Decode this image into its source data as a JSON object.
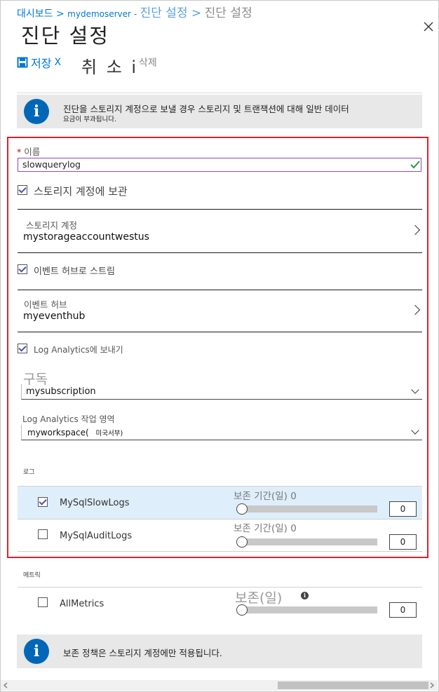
{
  "breadcrumb": {
    "item1": "대시보드 >",
    "item2": "mydemoserver -",
    "item3": "진단 설정 >",
    "current": "진단 설정"
  },
  "page_title": "진단 설정",
  "toolbar": {
    "save": "저장",
    "save_x": "X",
    "cancel": "취 소 i",
    "delete": "삭제"
  },
  "info_top": {
    "line1": "진단을 스토리지 계정으로 보낼 경우 스토리지 및 트랜잭션에 대해 일반 데이터",
    "line2": "요금이 부과됩니다."
  },
  "name": {
    "required": "*",
    "label": "이름",
    "value": "slowquerylog"
  },
  "storage": {
    "checkbox_label": "스토리지 계정에 보관",
    "checked": true,
    "account_label": "스토리지 계정",
    "account_value": "mystorageaccountwestus"
  },
  "eventhub": {
    "checkbox_label": "이벤트 허브로 스트림",
    "checked": true,
    "hub_label": "이벤트 허브",
    "hub_value": "myeventhub"
  },
  "log_analytics": {
    "checkbox_label": "Log Analytics에 보내기",
    "checked": true,
    "subscription_label": "구독",
    "subscription_value": "mysubscription",
    "workspace_label": "Log Analytics 작업 영역",
    "workspace_value": "myworkspace(",
    "workspace_region": "미국서부)"
  },
  "logs": {
    "section_label": "로그",
    "rows": [
      {
        "name": "MySqlSlowLogs",
        "checked": true,
        "retention_label": "보존 기간(일) 0",
        "retention_value": "0"
      },
      {
        "name": "MySqlAuditLogs",
        "checked": false,
        "retention_label": "보존 기간(일) 0",
        "retention_value": "0"
      }
    ]
  },
  "metrics": {
    "section_label": "메트릭",
    "rows": [
      {
        "name": "AllMetrics",
        "checked": false,
        "retention_label": "보존(일)",
        "retention_value": "0"
      }
    ]
  },
  "info_bottom": {
    "text": "보존 정책은 스토리지 계정에만 적용됩니다."
  },
  "colors": {
    "accent": "#0078d4",
    "highlight": "#e0202a",
    "selected_row": "#dfeefb"
  }
}
